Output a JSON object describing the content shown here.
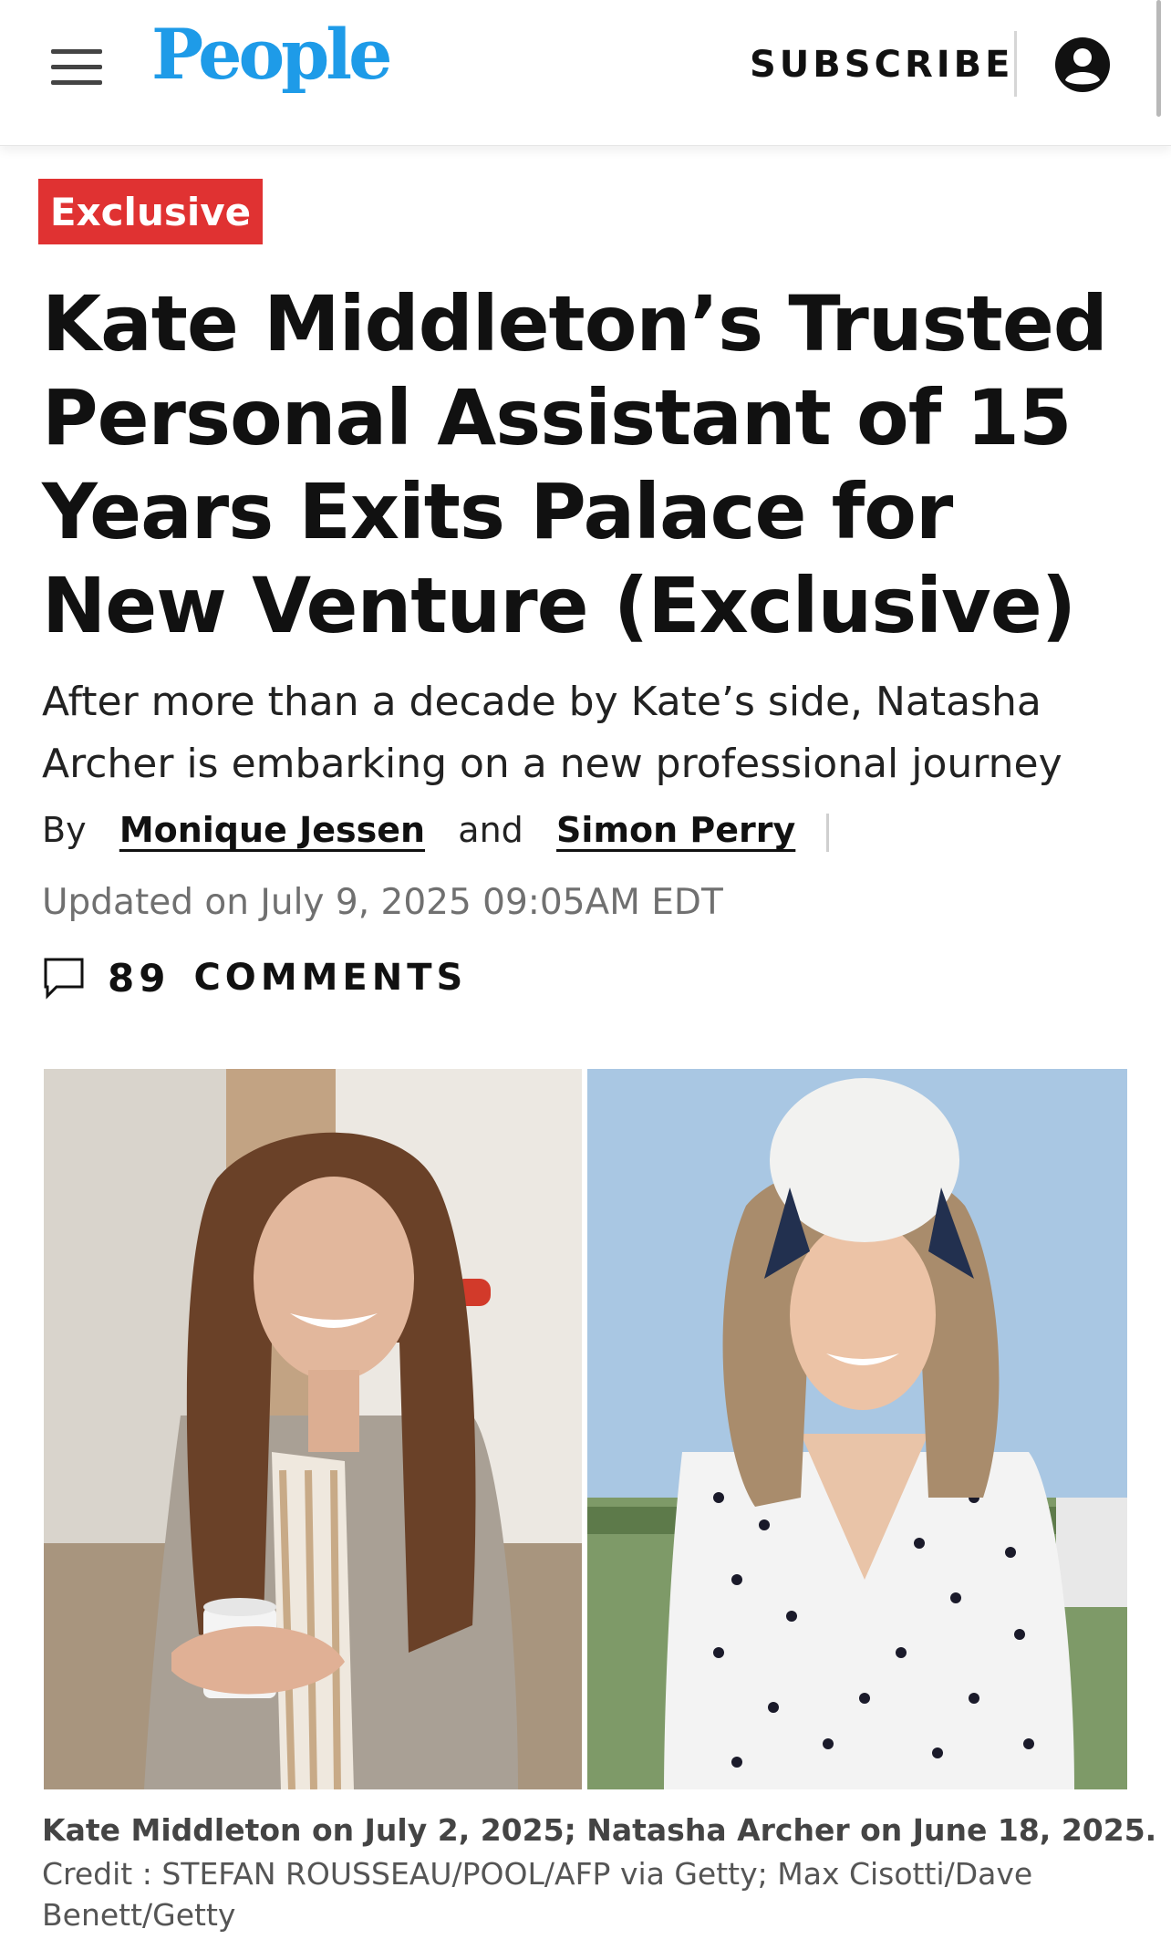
{
  "header": {
    "logo_text": "People",
    "subscribe_label": "SUBSCRIBE",
    "menu_icon": "hamburger-menu-icon",
    "account_icon": "user-account-icon",
    "brand_color": "#1e9be8"
  },
  "article": {
    "badge": "Exclusive",
    "badge_color": "#e03232",
    "headline": "Kate Middleton’s Trusted Personal Assistant of 15 Years Exits Palace for New Venture (Exclusive)",
    "dek": "After more than a decade by Kate’s side, Natasha Archer is embarking on a new professional journey",
    "byline": {
      "by": "By",
      "author1": "Monique Jessen",
      "conjunction": "and",
      "author2": "Simon Perry"
    },
    "updated": "Updated on July 9, 2025 09:05AM EDT",
    "comments": {
      "count": "89",
      "label": "COMMENTS",
      "icon": "comment-bubble-icon"
    },
    "image": {
      "caption": "Kate Middleton on July 2, 2025; Natasha Archer on June 18, 2025.",
      "credit": "Credit : STEFAN ROUSSEAU/POOL/AFP via Getty; Max Cisotti/Dave Benett/Getty"
    }
  }
}
